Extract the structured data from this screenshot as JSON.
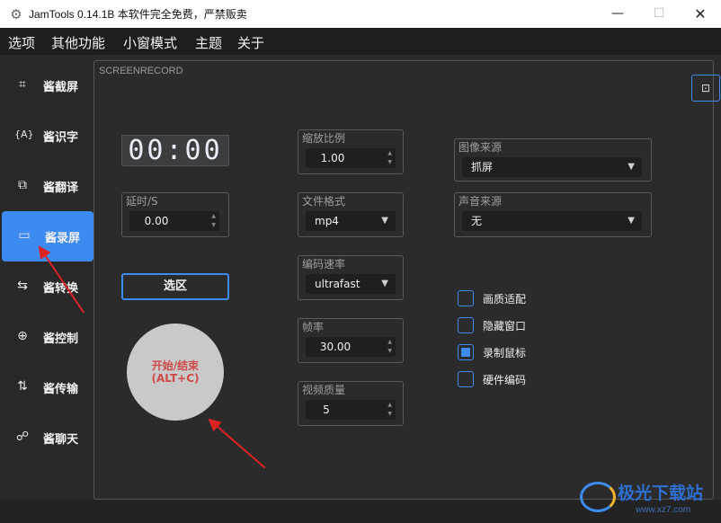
{
  "window": {
    "title": "JamTools 0.14.1B 本软件完全免费，严禁贩卖",
    "minimize_glyph": "—",
    "maximize_glyph": "☐",
    "close_glyph": "✕"
  },
  "menu": [
    "选项",
    "其他功能",
    "小窗模式",
    "主题",
    "关于"
  ],
  "sidebar": {
    "items": [
      {
        "label": "酱截屏",
        "icon": "crop-icon",
        "glyph": "⌗",
        "active": false
      },
      {
        "label": "酱识字",
        "icon": "text-recognition-icon",
        "glyph": "{A}",
        "active": false
      },
      {
        "label": "酱翻译",
        "icon": "translate-icon",
        "glyph": "⧉",
        "active": false
      },
      {
        "label": "酱录屏",
        "icon": "video-camera-icon",
        "glyph": "▭",
        "active": true
      },
      {
        "label": "酱转换",
        "icon": "convert-icon",
        "glyph": "⇆",
        "active": false
      },
      {
        "label": "酱控制",
        "icon": "control-icon",
        "glyph": "⊕",
        "active": false
      },
      {
        "label": "酱传输",
        "icon": "transfer-icon",
        "glyph": "⇅",
        "active": false
      },
      {
        "label": "酱聊天",
        "icon": "chat-icon",
        "glyph": "☍",
        "active": false
      }
    ]
  },
  "panel": {
    "title": "SCREENRECORD",
    "pin_glyph": "⊡",
    "timer": "00:00",
    "delay": {
      "label": "延时/S",
      "value": "0.00"
    },
    "select_area_label": "选区",
    "start_stop": {
      "line1": "开始/结束",
      "line2": "(ALT+C)"
    },
    "scale": {
      "label": "缩放比例",
      "value": "1.00"
    },
    "format": {
      "label": "文件格式",
      "value": "mp4"
    },
    "preset": {
      "label": "编码速率",
      "value": "ultrafast"
    },
    "fps": {
      "label": "帧率",
      "value": "30.00"
    },
    "quality": {
      "label": "视频质量",
      "value": "5"
    },
    "image_source": {
      "label": "图像来源",
      "value": "抓屏"
    },
    "audio_source": {
      "label": "声音来源",
      "value": "无"
    },
    "options": [
      {
        "label": "画质适配",
        "checked": false
      },
      {
        "label": "隐藏窗口",
        "checked": false
      },
      {
        "label": "录制鼠标",
        "checked": true
      },
      {
        "label": "硬件编码",
        "checked": false
      }
    ]
  },
  "watermark": {
    "text": "极光下载站",
    "url": "www.xz7.com"
  },
  "colors": {
    "accent": "#3d8bf0",
    "menubar": "#1e1e1f",
    "sidebar": "#282829",
    "panel": "#2b2b2c",
    "arrow": "#dd2222",
    "start_text": "#d04848"
  }
}
